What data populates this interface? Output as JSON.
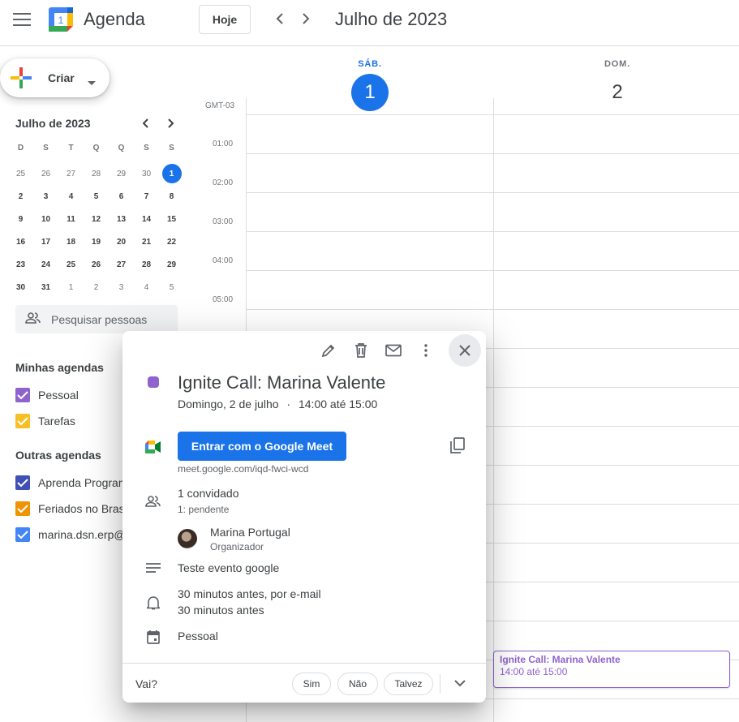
{
  "header": {
    "app_title": "Agenda",
    "logo_number": "1",
    "today_label": "Hoje",
    "month_label": "Julho de 2023"
  },
  "create": {
    "label": "Criar"
  },
  "mini_calendar": {
    "title": "Julho de 2023",
    "weekdays": [
      "D",
      "S",
      "T",
      "Q",
      "Q",
      "S",
      "S"
    ],
    "weeks": [
      [
        "25",
        "26",
        "27",
        "28",
        "29",
        "30",
        "1"
      ],
      [
        "2",
        "3",
        "4",
        "5",
        "6",
        "7",
        "8"
      ],
      [
        "9",
        "10",
        "11",
        "12",
        "13",
        "14",
        "15"
      ],
      [
        "16",
        "17",
        "18",
        "19",
        "20",
        "21",
        "22"
      ],
      [
        "23",
        "24",
        "25",
        "26",
        "27",
        "28",
        "29"
      ],
      [
        "30",
        "31",
        "1",
        "2",
        "3",
        "4",
        "5"
      ]
    ]
  },
  "search_people": {
    "placeholder": "Pesquisar pessoas"
  },
  "my_calendars": {
    "title": "Minhas agendas",
    "items": [
      {
        "label": "Pessoal",
        "color": "#8e63ce"
      },
      {
        "label": "Tarefas",
        "color": "#f6bf26"
      }
    ]
  },
  "other_calendars": {
    "title": "Outras agendas",
    "items": [
      {
        "label": "Aprenda Programar",
        "color": "#3f51b5"
      },
      {
        "label": "Feriados no Brasil",
        "color": "#f09300"
      },
      {
        "label": "marina.dsn.erp@",
        "color": "#4285f4"
      }
    ]
  },
  "week": {
    "timezone": "GMT-03",
    "days": [
      {
        "name": "SÁB.",
        "number": "1"
      },
      {
        "name": "DOM.",
        "number": "2"
      }
    ],
    "hours": [
      "01:00",
      "02:00",
      "03:00",
      "04:00",
      "05:00"
    ]
  },
  "event_chip": {
    "title": "Ignite Call: Marina Valente",
    "time": "14:00 até 15:00"
  },
  "popup": {
    "title": "Ignite Call: Marina Valente",
    "date": "Domingo, 2 de julho",
    "separator": "·",
    "time": "14:00 até 15:00",
    "meet_button": "Entrar com o Google Meet",
    "meet_link": "meet.google.com/iqd-fwci-wcd",
    "guests_count": "1 convidado",
    "guests_status": "1: pendente",
    "organizer_name": "Marina Portugal",
    "organizer_role": "Organizador",
    "description": "Teste evento google",
    "reminder_1": "30 minutos antes, por e-mail",
    "reminder_2": "30 minutos antes",
    "calendar": "Pessoal",
    "rsvp_label": "Vai?",
    "rsvp_yes": "Sim",
    "rsvp_no": "Não",
    "rsvp_maybe": "Talvez"
  },
  "colors": {
    "accent": "#1a73e8",
    "event": "#8e63ce"
  }
}
